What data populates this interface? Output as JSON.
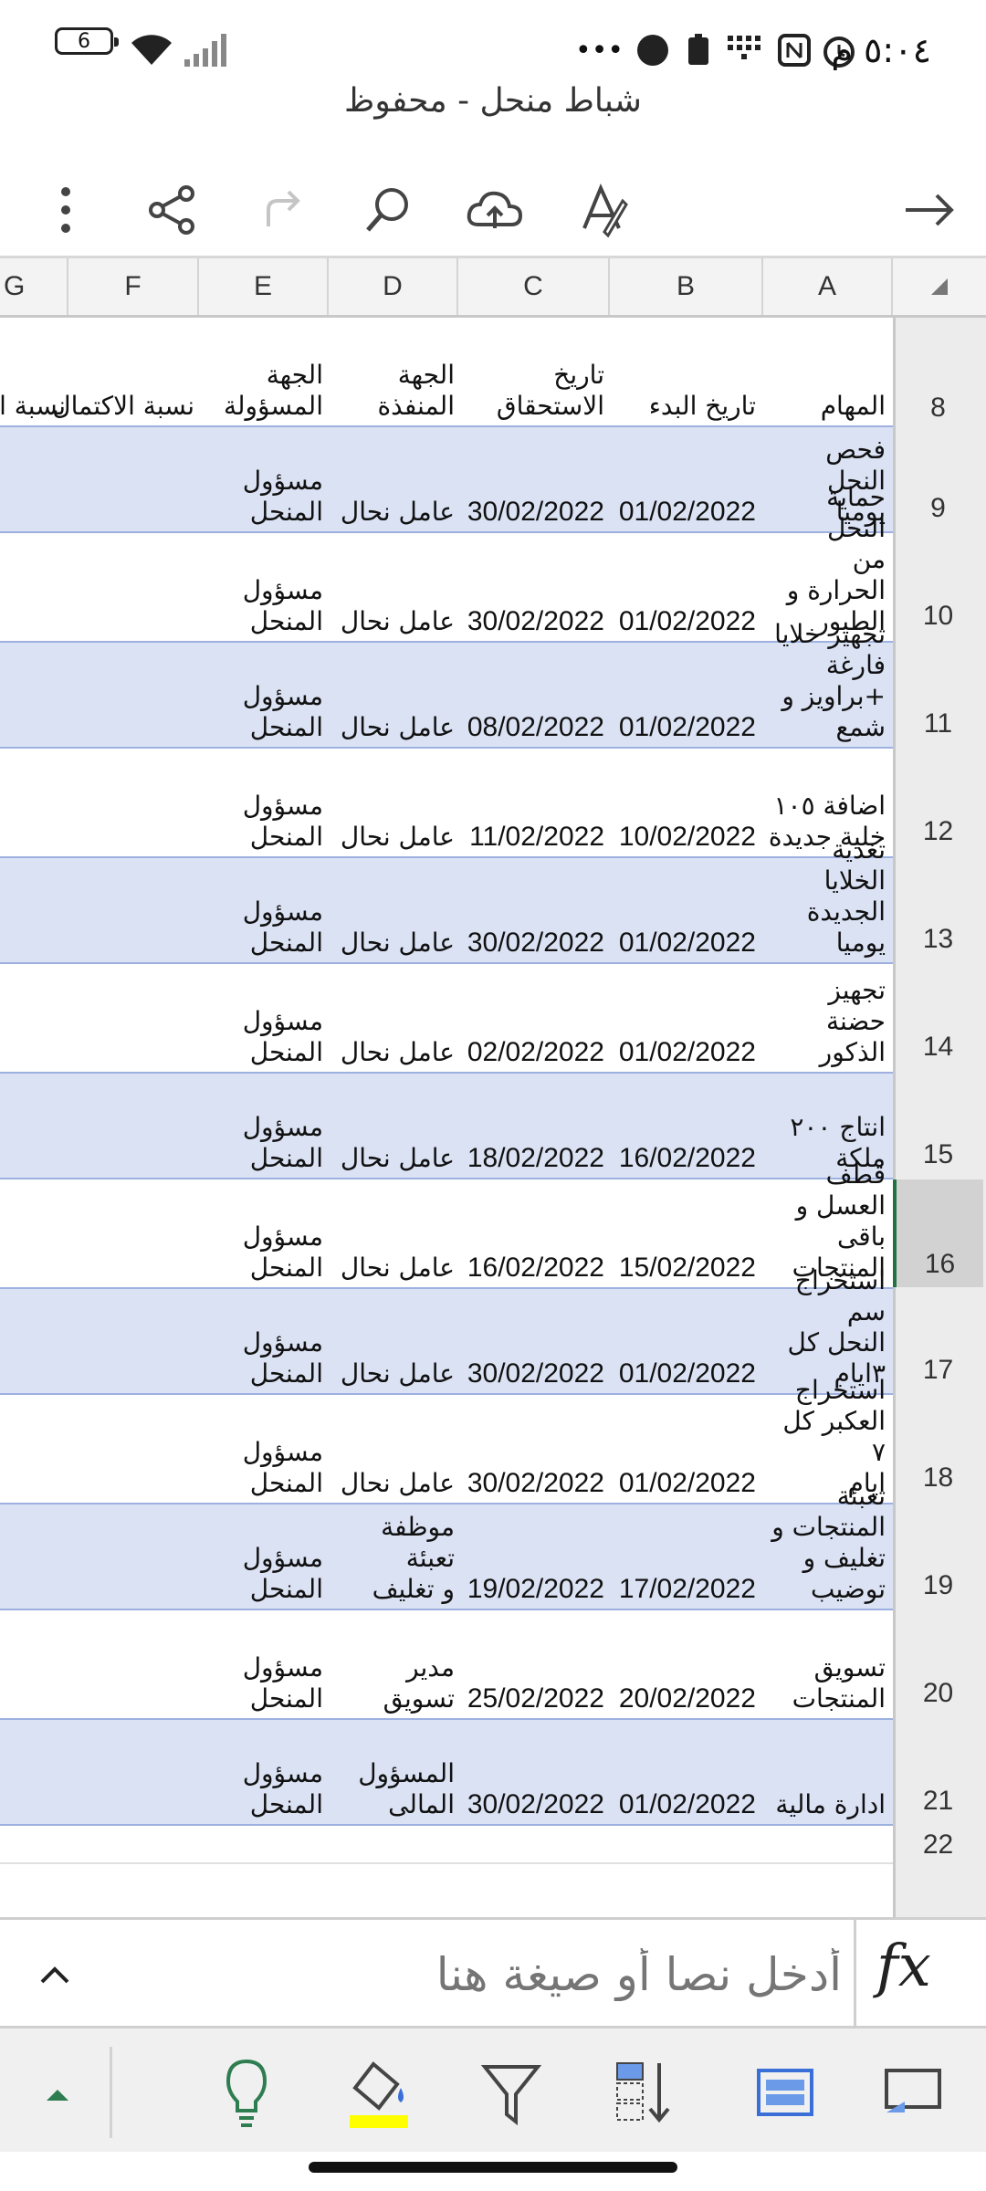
{
  "status": {
    "battery_level": "6",
    "time": "٥:٠٤ م"
  },
  "doc": {
    "title": "شباط منحل - محفوظ"
  },
  "toolbar": {
    "icons": [
      "more-icon",
      "share-icon",
      "redo-icon",
      "search-icon",
      "cloud-upload-icon",
      "draw-icon",
      "forward-arrow-icon"
    ]
  },
  "columns": [
    "G",
    "F",
    "E",
    "D",
    "C",
    "B",
    "A"
  ],
  "header_row": {
    "number": "8",
    "task": "المهام",
    "start": "تاريخ البدء",
    "due": "تاريخ الاستحقاق",
    "executor": "الجهة المنفذة",
    "responsible": "الجهة\nالمسؤولة",
    "completion": "نسبة الاكتمال",
    "remaining": "نسبة المه"
  },
  "rows": [
    {
      "number": "9",
      "task": "فحص النحل\nيوميا",
      "start": "01/02/2022",
      "due": "30/02/2022",
      "executor": "عامل نحال",
      "responsible": "مسؤول\nالمنحل"
    },
    {
      "number": "10",
      "task": "حماية النحل\nمن الحرارة و\nالطيور",
      "start": "01/02/2022",
      "due": "30/02/2022",
      "executor": "عامل نحال",
      "responsible": "مسؤول\nالمنحل"
    },
    {
      "number": "11",
      "task": "تجهيز خلايا\nفارغة\n+براويز و\nشمع",
      "start": "01/02/2022",
      "due": "08/02/2022",
      "executor": "عامل نحال",
      "responsible": "مسؤول\nالمنحل"
    },
    {
      "number": "12",
      "task": "اضافة ١٠٥\nخلية جديدة",
      "start": "10/02/2022",
      "due": "11/02/2022",
      "executor": "عامل نحال",
      "responsible": "مسؤول\nالمنحل"
    },
    {
      "number": "13",
      "task": "تغذية الخلايا\nالجديدة يوميا",
      "start": "01/02/2022",
      "due": "30/02/2022",
      "executor": "عامل نحال",
      "responsible": "مسؤول\nالمنحل"
    },
    {
      "number": "14",
      "task": "تجهيز حضنة\nالذكور",
      "start": "01/02/2022",
      "due": "02/02/2022",
      "executor": "عامل نحال",
      "responsible": "مسؤول\nالمنحل"
    },
    {
      "number": "15",
      "task": "انتاج ٢٠٠\nملكة",
      "start": "16/02/2022",
      "due": "18/02/2022",
      "executor": "عامل نحال",
      "responsible": "مسؤول\nالمنحل"
    },
    {
      "number": "16",
      "task": "قطف العسل و\nباقى المنتجات",
      "start": "15/02/2022",
      "due": "16/02/2022",
      "executor": "عامل نحال",
      "responsible": "مسؤول\nالمنحل"
    },
    {
      "number": "17",
      "task": "استخراج سم\nالنحل كل\n٣ايام",
      "start": "01/02/2022",
      "due": "30/02/2022",
      "executor": "عامل نحال",
      "responsible": "مسؤول\nالمنحل"
    },
    {
      "number": "18",
      "task": "استخراج\nالعكبر كل ٧\nايام",
      "start": "01/02/2022",
      "due": "30/02/2022",
      "executor": "عامل نحال",
      "responsible": "مسؤول\nالمنحل"
    },
    {
      "number": "19",
      "task": "تعبئة\nالمنتجات و\nتغليف و\nتوضيب",
      "start": "17/02/2022",
      "due": "19/02/2022",
      "executor": "موظفة تعبئة\nو تغليف",
      "responsible": "مسؤول\nالمنحل"
    },
    {
      "number": "20",
      "task": "تسويق\nالمنتجات",
      "start": "20/02/2022",
      "due": "25/02/2022",
      "executor": "مدير تسويق",
      "responsible": "مسؤول\nالمنحل"
    },
    {
      "number": "21",
      "task": "ادارة مالية",
      "start": "01/02/2022",
      "due": "30/02/2022",
      "executor": "المسؤول\nالمالى",
      "responsible": "مسؤول\nالمنحل"
    }
  ],
  "extra_rows": [
    "22"
  ],
  "formula_bar": {
    "placeholder": "أدخل نصا أو صيغة هنا",
    "fx_label": "fx"
  },
  "bottom_toolbar": {
    "icons": [
      "expand-up-icon",
      "ideas-icon",
      "fill-color-icon",
      "filter-icon",
      "sort-icon",
      "freeze-panes-icon",
      "comment-icon"
    ]
  },
  "colors": {
    "band": "#dbe2f4",
    "band_border": "#9db0e0",
    "selected_row": "#217346",
    "fill_highlight": "#ffff00",
    "ideas": "#217346"
  }
}
